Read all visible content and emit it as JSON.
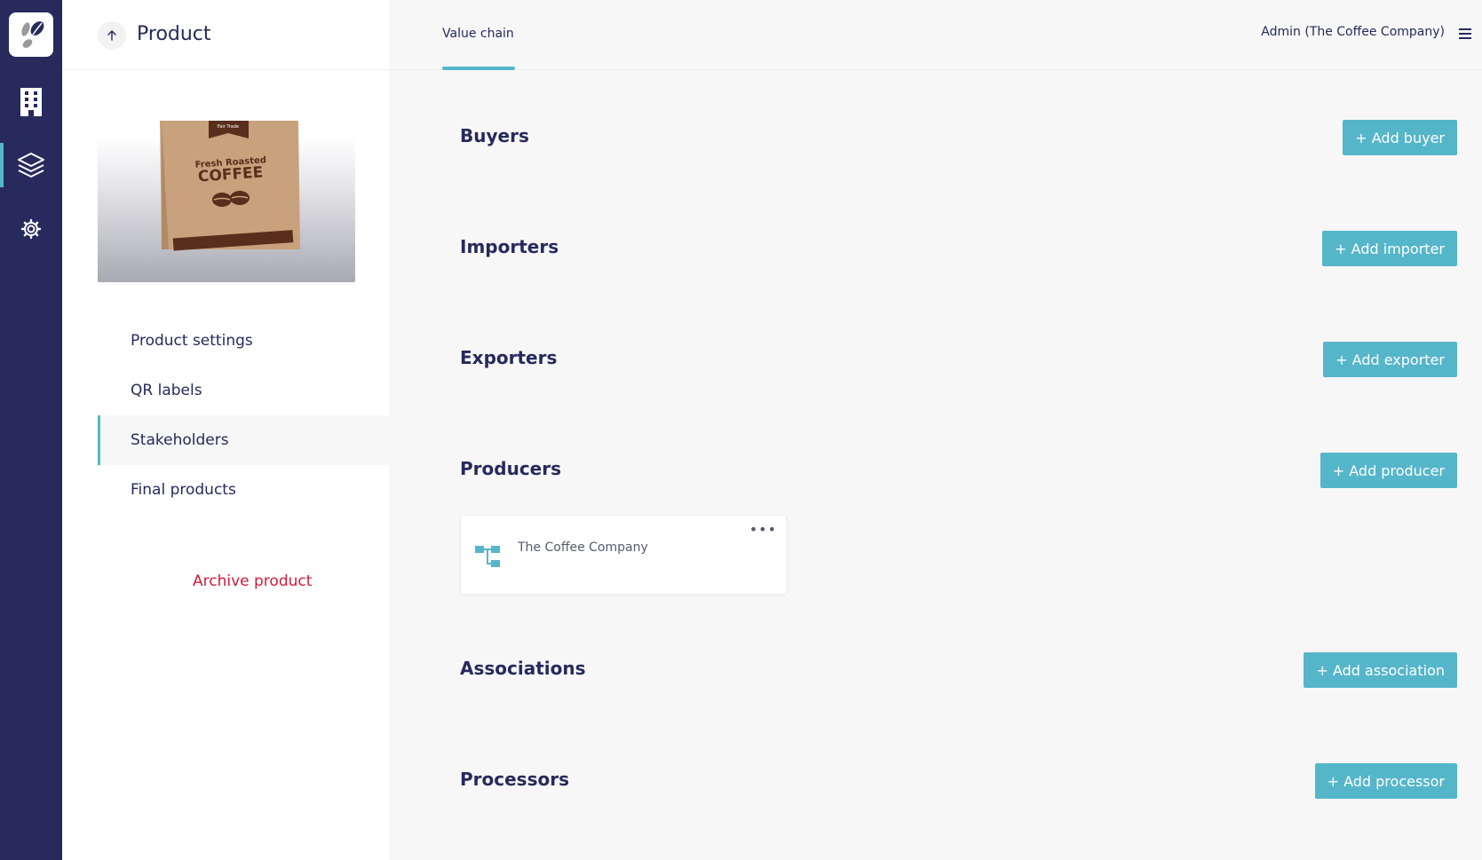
{
  "header": {
    "title": "Product",
    "tab": "Value chain",
    "user": "Admin (The Coffee Company)"
  },
  "sidebar": {
    "items": [
      {
        "label": "Product settings"
      },
      {
        "label": "QR labels"
      },
      {
        "label": "Stakeholders"
      },
      {
        "label": "Final products"
      }
    ],
    "archive_label": "Archive product"
  },
  "product_image": {
    "line1": "Fresh Roasted",
    "line2": "COFFEE",
    "line3": "Fair Trade"
  },
  "sections": [
    {
      "label": "Buyers",
      "button": "+ Add buyer"
    },
    {
      "label": "Importers",
      "button": "+ Add importer"
    },
    {
      "label": "Exporters",
      "button": "+ Add exporter"
    },
    {
      "label": "Producers",
      "button": "+ Add producer"
    },
    {
      "label": "Associations",
      "button": "+ Add association"
    },
    {
      "label": "Processors",
      "button": "+ Add processor"
    }
  ],
  "producer_card": {
    "name": "The Coffee Company",
    "more": "•••"
  },
  "colors": {
    "rail": "#262a5c",
    "accent": "#55b6ca",
    "danger": "#d11a3a"
  }
}
